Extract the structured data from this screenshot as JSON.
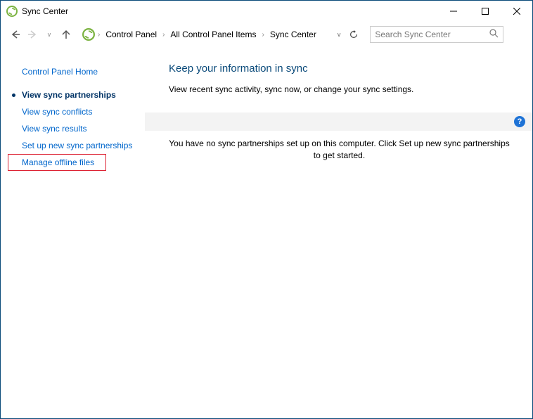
{
  "window": {
    "title": "Sync Center"
  },
  "nav": {
    "crumbs": [
      "Control Panel",
      "All Control Panel Items",
      "Sync Center"
    ],
    "search_placeholder": "Search Sync Center"
  },
  "sidebar": {
    "home": "Control Panel Home",
    "items": [
      {
        "label": "View sync partnerships",
        "selected": true
      },
      {
        "label": "View sync conflicts"
      },
      {
        "label": "View sync results"
      },
      {
        "label": "Set up new sync partnerships"
      },
      {
        "label": "Manage offline files",
        "highlight": true
      }
    ]
  },
  "main": {
    "heading": "Keep your information in sync",
    "subtext": "View recent sync activity, sync now, or change your sync settings.",
    "empty_msg": "You have no sync partnerships set up on this computer. Click Set up new sync partnerships to get started."
  }
}
